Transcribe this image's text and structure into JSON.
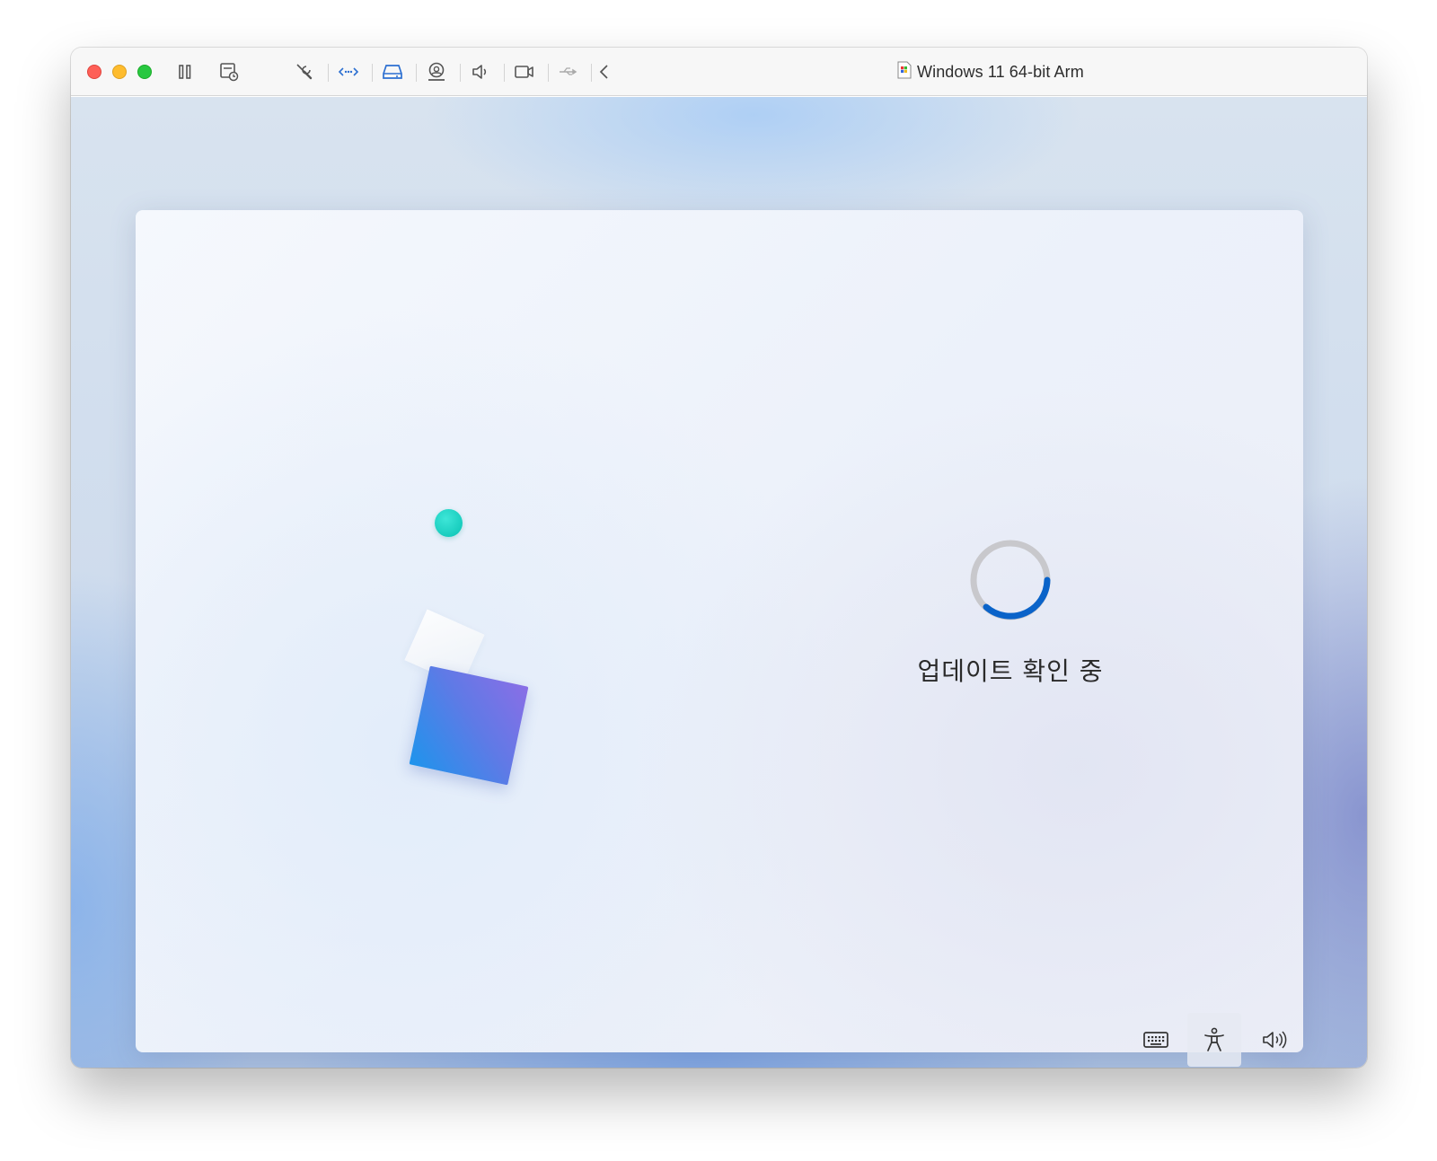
{
  "window": {
    "title": "Windows 11 64-bit Arm",
    "title_icon": "vm-document-icon"
  },
  "toolbar": {
    "items": [
      {
        "name": "pause-icon"
      },
      {
        "name": "snapshot-icon"
      },
      {
        "name": "settings-wrench-icon"
      },
      {
        "name": "network-icon"
      },
      {
        "name": "hard-disk-icon"
      },
      {
        "name": "camera-user-icon"
      },
      {
        "name": "sound-icon"
      },
      {
        "name": "video-camera-icon"
      },
      {
        "name": "usb-icon"
      },
      {
        "name": "chevron-left-icon"
      }
    ]
  },
  "setup": {
    "status": "업데이트 확인 중"
  },
  "bottom_bar": {
    "items": [
      {
        "name": "keyboard-icon"
      },
      {
        "name": "accessibility-icon",
        "active": true
      },
      {
        "name": "volume-icon"
      }
    ]
  },
  "colors": {
    "spinner_track": "#c8c8cc",
    "spinner_arc": "#0a63c9",
    "accent_teal": "#08c2b3",
    "accent_blue": "#1e94ec",
    "accent_purple": "#8a6ee6"
  }
}
